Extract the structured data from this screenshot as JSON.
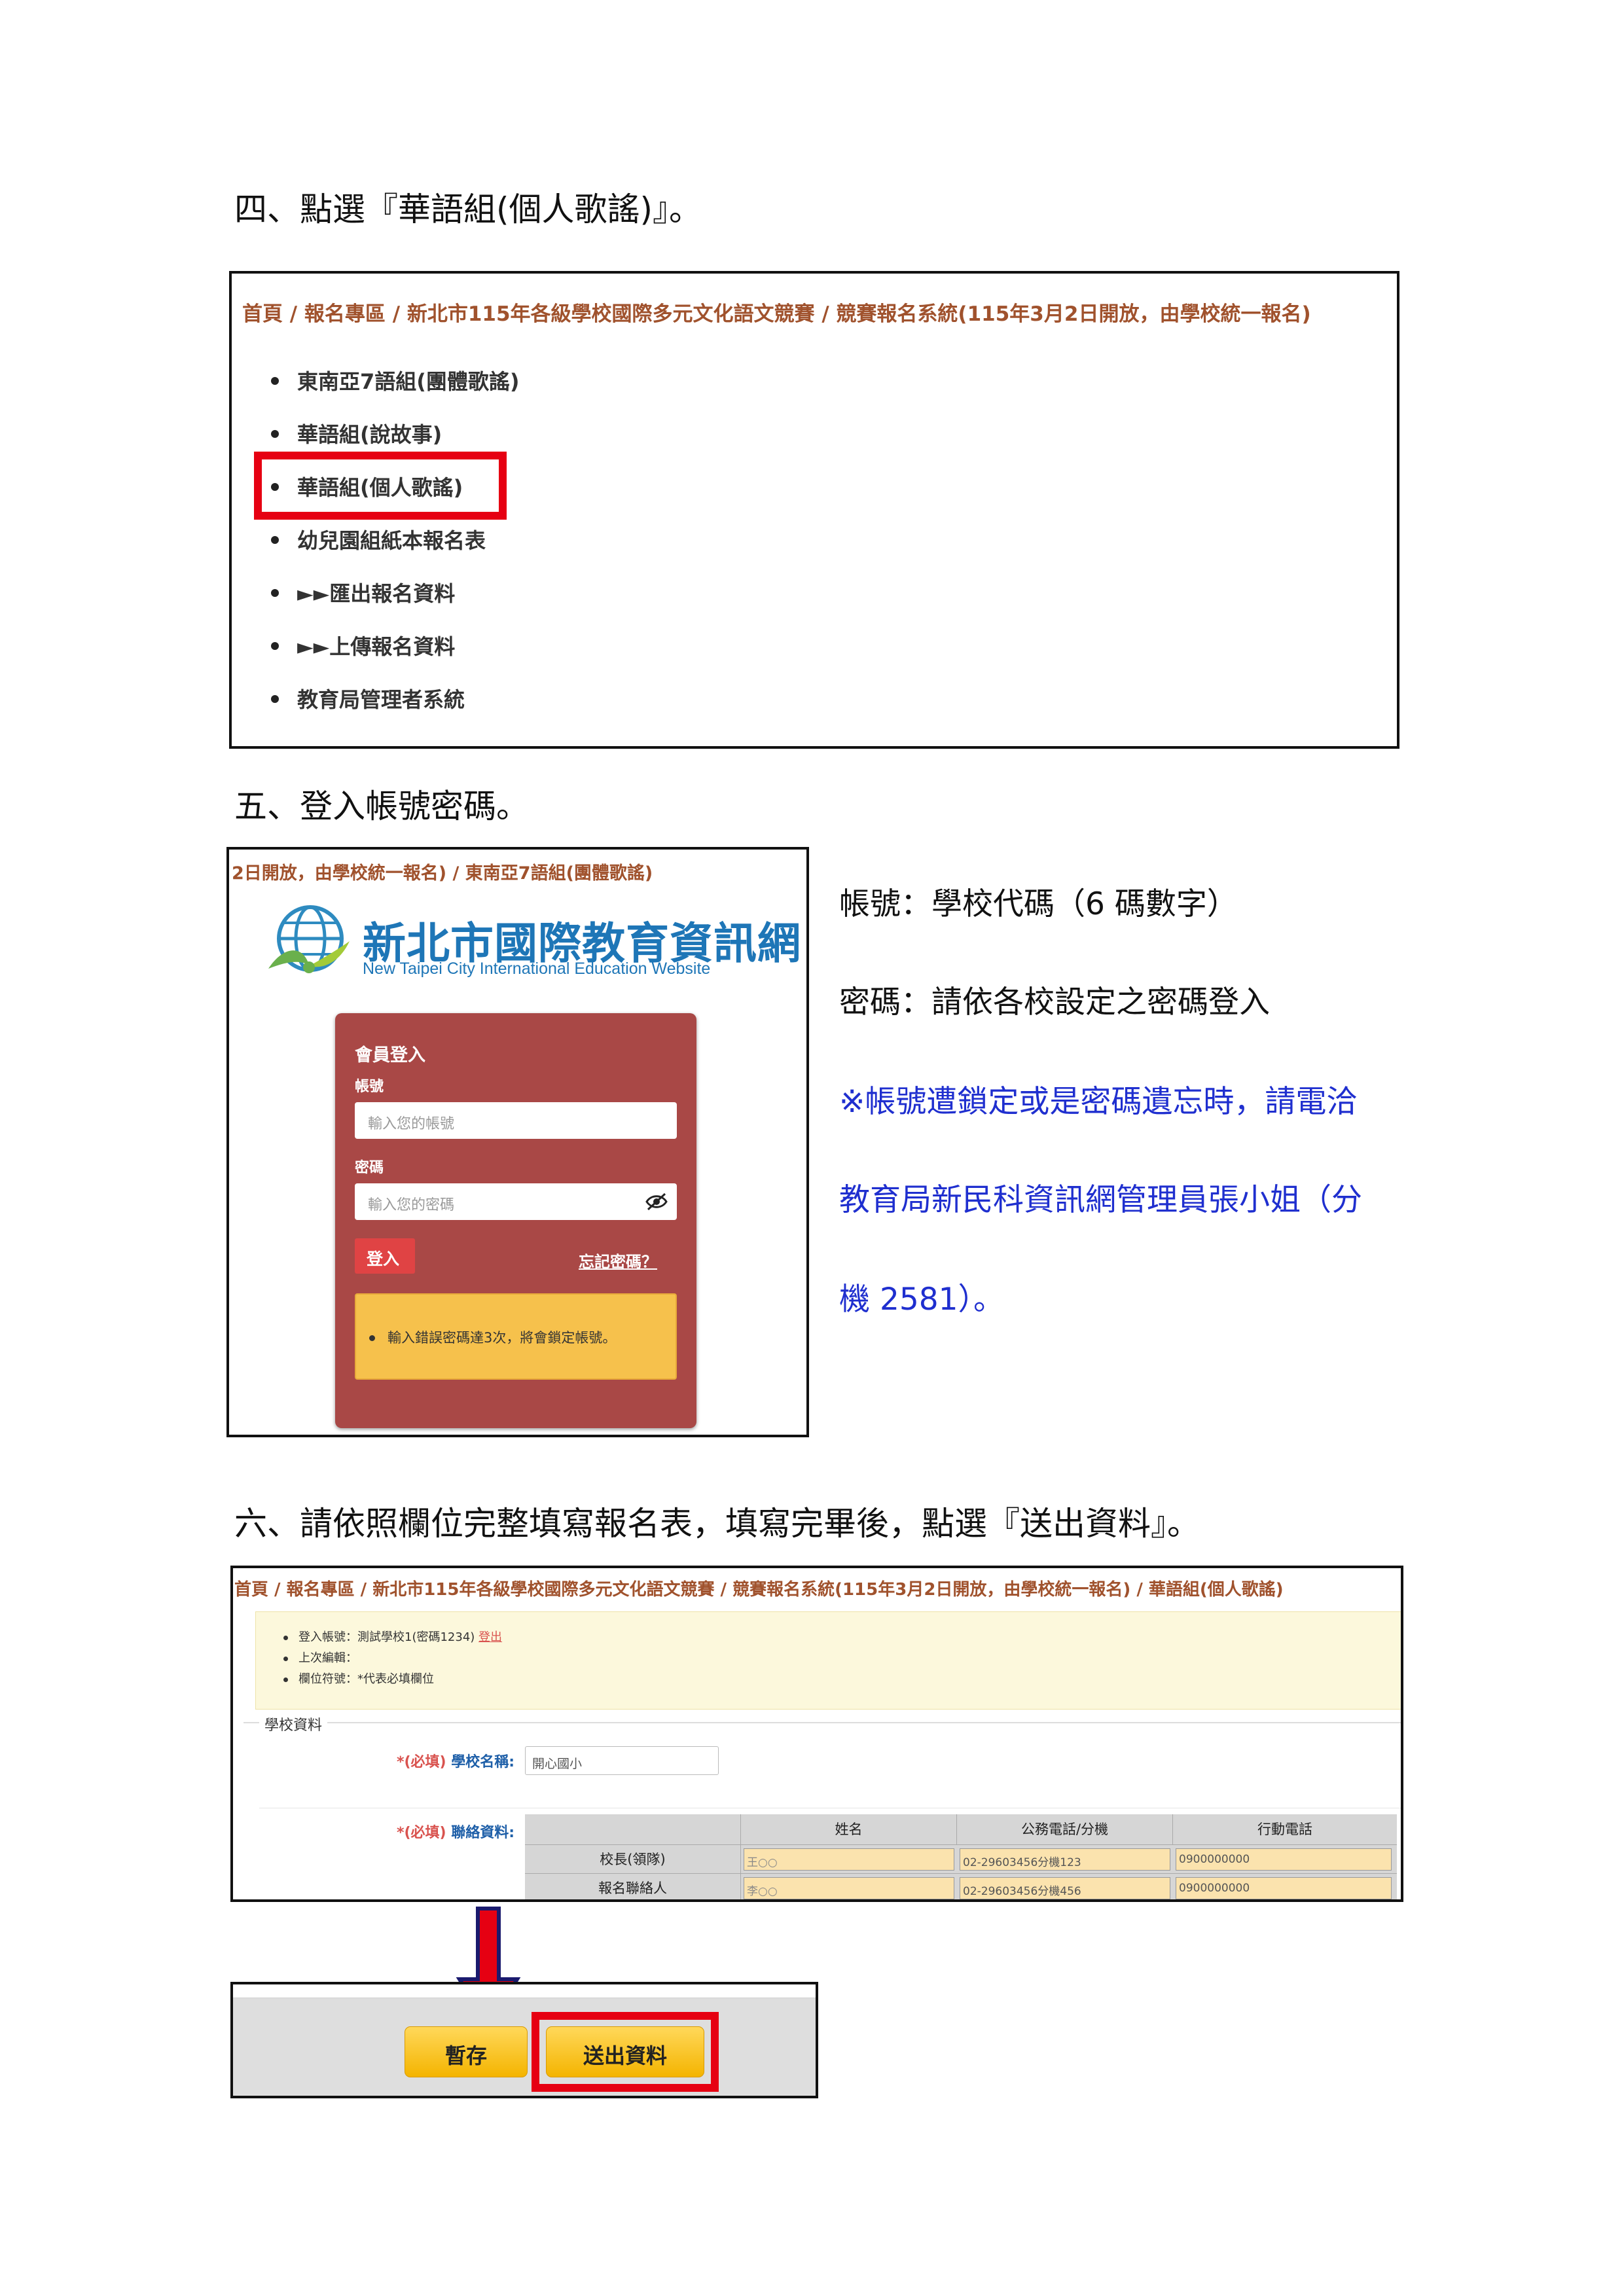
{
  "steps": {
    "s4": "四、點選『華語組(個人歌謠)』。",
    "s5": "五、登入帳號密碼。",
    "s6": "六、請依照欄位完整填寫報名表，填寫完畢後，點選『送出資料』。"
  },
  "shot1": {
    "breadcrumb": "首頁 / 報名專區 / 新北市115年各級學校國際多元文化語文競賽 / 競賽報名系統(115年3月2日開放，由學校統一報名)",
    "items": [
      "東南亞7語組(團體歌謠)",
      "華語組(說故事)",
      "華語組(個人歌謠)",
      "幼兒園組紙本報名表",
      "►►匯出報名資料",
      "►►上傳報名資料",
      "教育局管理者系統"
    ]
  },
  "shot2": {
    "breadcrumb": "2日開放，由學校統一報名) / 東南亞7語組(團體歌謠)",
    "logo_title": "新北市國際教育資訊網",
    "logo_subtitle": "New Taipei City International Education Website",
    "panel_title": "會員登入",
    "account_label": "帳號",
    "account_placeholder": "輸入您的帳號",
    "password_label": "密碼",
    "password_placeholder": "輸入您的密碼",
    "login_button": "登入",
    "forgot_link": "忘記密碼？",
    "warning": "輸入錯誤密碼達3次，將會鎖定帳號。"
  },
  "notes": {
    "account": "帳號：學校代碼（6 碼數字）",
    "password": "密碼：請依各校設定之密碼登入",
    "lock_line1": "※帳號遭鎖定或是密碼遺忘時，請電洽",
    "lock_line2": "教育局新民科資訊網管理員張小姐（分",
    "lock_line3": "機 2581）。"
  },
  "shot3": {
    "breadcrumb": "首頁 / 報名專區 / 新北市115年各級學校國際多元文化語文競賽 / 競賽報名系統(115年3月2日開放，由學校統一報名) / 華語組(個人歌謠)",
    "info_login_prefix": "登入帳號：測試學校1(密碼1234)",
    "info_logout": "登出",
    "info_last_edit": "上次編輯：",
    "info_legend": "欄位符號：*代表必填欄位",
    "section_title": "學校資料",
    "required_tag": "*(必填)",
    "school_name_label": "學校名稱:",
    "school_name_value": "開心國小",
    "contact_label": "聯絡資料:",
    "table_headers": [
      "姓名",
      "公務電話/分機",
      "行動電話"
    ],
    "rows": [
      {
        "role": "校長(領隊)",
        "name": "王○○",
        "phone": "02-29603456分機123",
        "mobile": "0900000000"
      },
      {
        "role": "報名聯絡人",
        "name": "李○○",
        "phone": "02-29603456分機456",
        "mobile": "0900000000"
      }
    ]
  },
  "shot4": {
    "save_button": "暫存",
    "submit_button": "送出資料"
  },
  "colors": {
    "highlight": "#e60012",
    "breadcrumb": "#a0522d",
    "login_panel": "#a94846",
    "warning_bg": "#f6c14c",
    "note_blue": "#1f2fcf",
    "arrow_fill": "#e60012",
    "arrow_outline": "#1a1a6e"
  }
}
